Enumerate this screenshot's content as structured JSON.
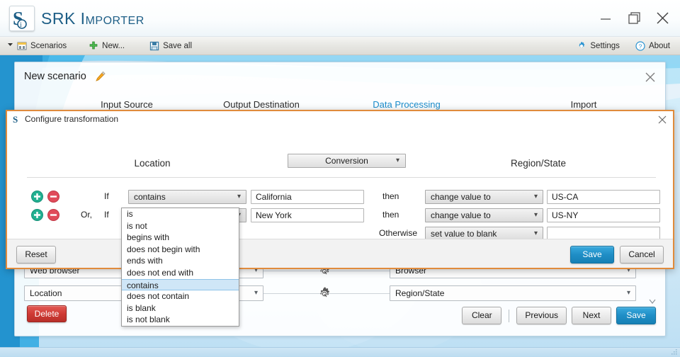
{
  "window": {
    "app_title": "SRK Importer",
    "logo_icon": "srk-logo-icon",
    "minimize_icon": "minimize-icon",
    "maximize_icon": "maximize-restore-icon",
    "close_icon": "close-icon"
  },
  "menubar": {
    "items": [
      {
        "label": "Scenarios",
        "icon": "scenarios-icon",
        "has_dropdown_arrow": true
      },
      {
        "label": "New...",
        "icon": "plus-green-icon",
        "has_dropdown_arrow": false
      },
      {
        "label": "Save all",
        "icon": "floppy-save-icon",
        "has_dropdown_arrow": false
      }
    ],
    "right_items": [
      {
        "label": "Settings",
        "icon": "gear-blue-icon"
      },
      {
        "label": "About",
        "icon": "question-circle-icon"
      }
    ]
  },
  "scenario": {
    "title": "New scenario",
    "edit_icon": "pencil-icon",
    "close_icon": "close-icon",
    "tabs": [
      {
        "label": "Input Source",
        "active": false
      },
      {
        "label": "Output Destination",
        "active": false
      },
      {
        "label": "Data Processing",
        "active": true
      },
      {
        "label": "Import",
        "active": false
      }
    ],
    "accent_color": "#1a8ccb",
    "mappings": [
      {
        "source": "Web browser",
        "target": "Browser",
        "gear_icon": "gear-icon"
      },
      {
        "source": "Location",
        "target": "Region/State",
        "gear_icon": "gear-icon"
      }
    ],
    "delete_label": "Delete",
    "footer_buttons": [
      "Clear",
      "Previous",
      "Next",
      "Save"
    ],
    "primary_button": "Save"
  },
  "dialog": {
    "title": "Configure transformation",
    "logo_icon": "srk-logo-icon",
    "close_icon": "close-icon",
    "border_color": "#e08b3c",
    "source_column": "Location",
    "target_column": "Region/State",
    "conversion_select": "Conversion",
    "caret_icon": "chevron-down-icon",
    "add_icon": "plus-circle-icon",
    "remove_icon": "minus-circle-icon",
    "rules": [
      {
        "conjunction": "",
        "if_label": "If",
        "operator": "contains",
        "operand": "California",
        "then_label": "then",
        "action": "change value to",
        "action_value": "US-CA"
      },
      {
        "conjunction": "Or,",
        "if_label": "If",
        "operator": "contains",
        "operand": "New York",
        "then_label": "then",
        "action": "change value to",
        "action_value": "US-NY"
      }
    ],
    "otherwise": {
      "label": "Otherwise",
      "action": "set value to blank",
      "action_value": ""
    },
    "reset_label": "Reset",
    "save_label": "Save",
    "cancel_label": "Cancel"
  },
  "dropdown": {
    "selected": "contains",
    "options": [
      "is",
      "is not",
      "begins with",
      "does not begin with",
      "ends with",
      "does not end with",
      "contains",
      "does not contain",
      "is blank",
      "is not blank"
    ],
    "highlight_color": "#cfe6f7"
  }
}
